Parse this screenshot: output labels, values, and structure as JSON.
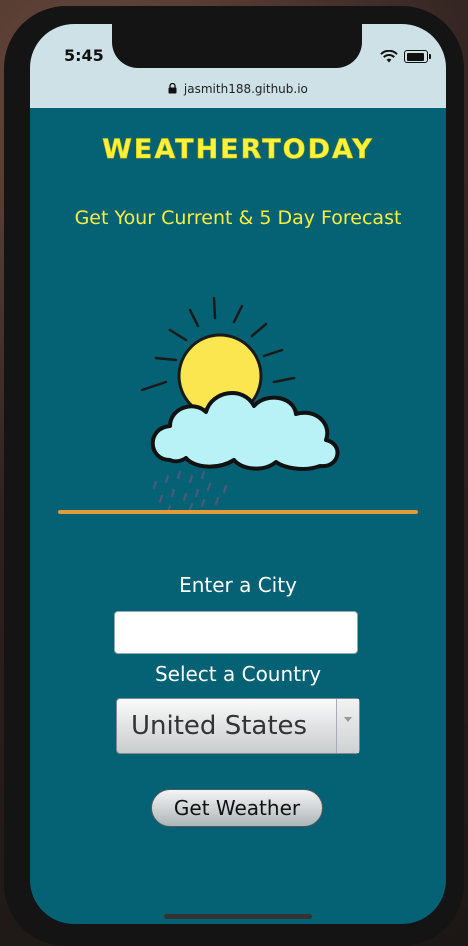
{
  "status_bar": {
    "time": "5:45",
    "url": "jasmith188.github.io"
  },
  "icons": {
    "wifi": "wifi-icon",
    "battery": "battery-icon",
    "lock": "lock-icon",
    "weather": "sun-cloud-rain-illustration"
  },
  "header": {
    "title": "WeatherToday",
    "subtitle": "Get Your Current & 5 Day Forecast"
  },
  "form": {
    "city_label": "Enter a City",
    "city_value": "",
    "country_label": "Select a Country",
    "country_value": "United States",
    "submit_label": "Get Weather"
  },
  "colors": {
    "background": "#056174",
    "title": "#fff13d",
    "divider": "#e39b3c",
    "status_bar": "#cde1e6"
  }
}
